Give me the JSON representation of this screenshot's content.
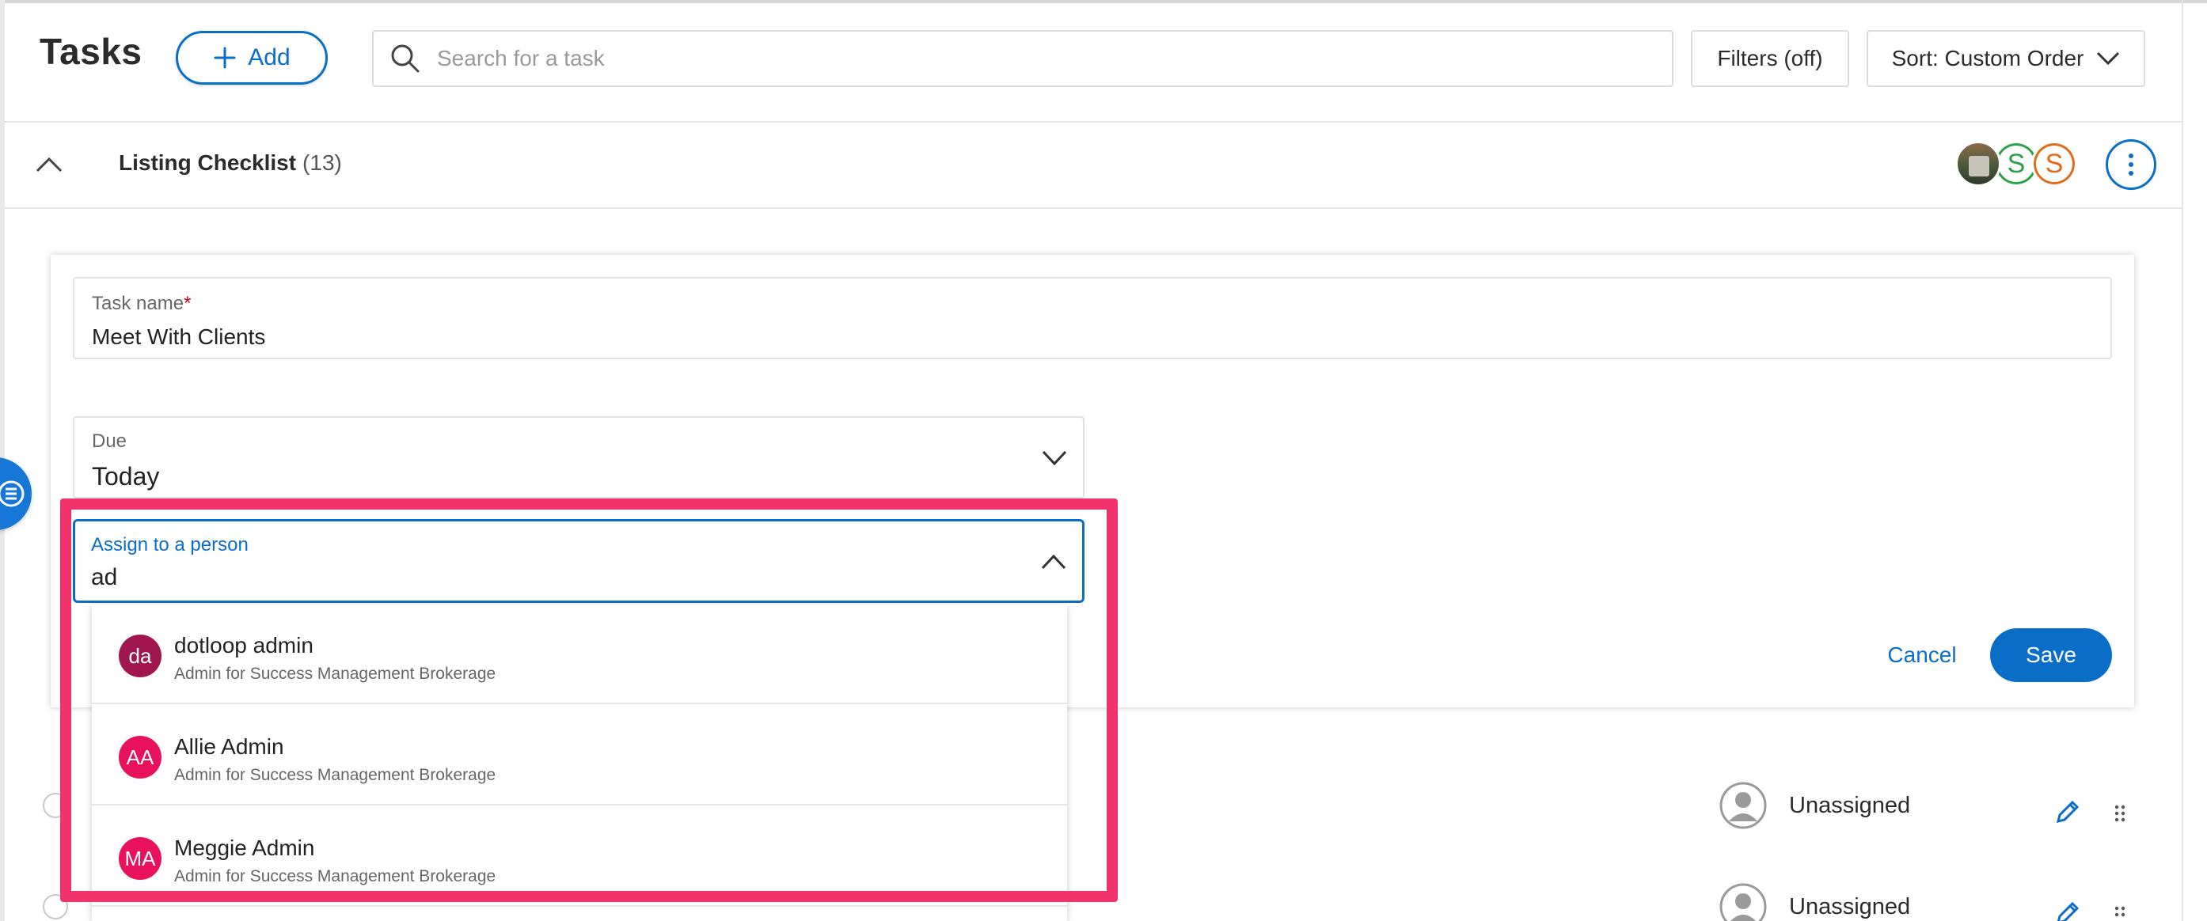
{
  "header": {
    "title": "Tasks",
    "add_label": "Add",
    "search_placeholder": "Search for a task",
    "filters_label": "Filters (off)",
    "sort_label": "Sort: Custom Order"
  },
  "checklist": {
    "title": "Listing Checklist",
    "count": "(13)",
    "avatars": [
      {
        "initial": "",
        "type": "photo"
      },
      {
        "initial": "S",
        "color": "#2aa046"
      },
      {
        "initial": "S",
        "color": "#e06a17"
      }
    ]
  },
  "form": {
    "task_name_label": "Task name",
    "required_marker": "*",
    "task_name_value": "Meet With Clients",
    "due_label": "Due",
    "due_value": "Today",
    "assign_label": "Assign to a person",
    "assign_value": "ad",
    "cancel_label": "Cancel",
    "save_label": "Save"
  },
  "dropdown": {
    "options": [
      {
        "initials": "da",
        "name": "dotloop admin",
        "subtitle": "Admin for Success Management Brokerage",
        "color": "#a0174f"
      },
      {
        "initials": "AA",
        "name": "Allie Admin",
        "subtitle": "Admin for Success Management Brokerage",
        "color": "#e8115b"
      },
      {
        "initials": "MA",
        "name": "Meggie Admin",
        "subtitle": "Admin for Success Management Brokerage",
        "color": "#e8115b"
      }
    ]
  },
  "rows": [
    {
      "assignee": "Unassigned"
    },
    {
      "assignee": "Unassigned"
    }
  ],
  "colors": {
    "accent": "#0a6ec9",
    "highlight": "#f0336a"
  },
  "icons": [
    "plus-icon",
    "search-icon",
    "chevron-down-icon",
    "chevron-up-icon",
    "more-vertical-icon",
    "person-icon",
    "pencil-icon",
    "drag-handle-icon",
    "list-icon"
  ]
}
